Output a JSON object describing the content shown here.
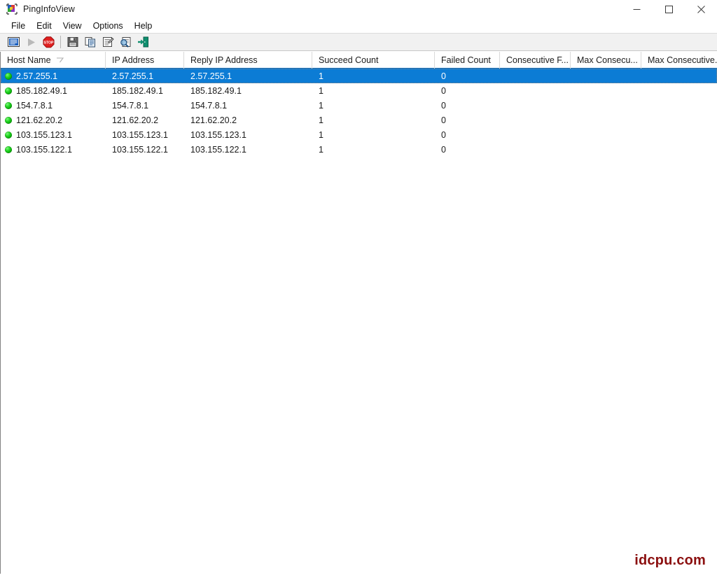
{
  "window": {
    "title": "PingInfoView",
    "app_icon": "app-icon",
    "controls": {
      "minimize": "minimize-button",
      "maximize": "maximize-button",
      "close": "close-button"
    }
  },
  "menubar": {
    "items": [
      {
        "label": "File"
      },
      {
        "label": "Edit"
      },
      {
        "label": "View"
      },
      {
        "label": "Options"
      },
      {
        "label": "Help"
      }
    ]
  },
  "toolbar": {
    "buttons": [
      {
        "name": "list-view-icon",
        "title": "Show Ping Window"
      },
      {
        "name": "play-icon",
        "title": "Resume"
      },
      {
        "name": "stop-icon",
        "title": "Stop"
      },
      {
        "name": "save-icon",
        "title": "Save"
      },
      {
        "name": "copy-icon",
        "title": "Copy"
      },
      {
        "name": "properties-icon",
        "title": "Properties"
      },
      {
        "name": "find-icon",
        "title": "Find"
      },
      {
        "name": "exit-icon",
        "title": "Exit"
      }
    ]
  },
  "listview": {
    "sort_column": "Host Name",
    "sort_direction": "descending",
    "selected_row_index": 0,
    "columns": [
      {
        "label": "Host Name",
        "width": 150
      },
      {
        "label": "IP Address",
        "width": 112
      },
      {
        "label": "Reply IP Address",
        "width": 183
      },
      {
        "label": "Succeed Count",
        "width": 175
      },
      {
        "label": "Failed Count",
        "width": 93
      },
      {
        "label": "Consecutive F...",
        "width": 101
      },
      {
        "label": "Max Consecu...",
        "width": 101
      },
      {
        "label": "Max Consecutive...",
        "width": 109
      }
    ],
    "rows": [
      {
        "status": "ok",
        "host_name": "2.57.255.1",
        "ip_address": "2.57.255.1",
        "reply_ip_address": "2.57.255.1",
        "succeed_count": "1",
        "failed_count": "0",
        "consecutive_failed": "",
        "max_consecutive_succeeded": "",
        "max_consecutive_failed": ""
      },
      {
        "status": "ok",
        "host_name": "185.182.49.1",
        "ip_address": "185.182.49.1",
        "reply_ip_address": "185.182.49.1",
        "succeed_count": "1",
        "failed_count": "0",
        "consecutive_failed": "",
        "max_consecutive_succeeded": "",
        "max_consecutive_failed": ""
      },
      {
        "status": "ok",
        "host_name": "154.7.8.1",
        "ip_address": "154.7.8.1",
        "reply_ip_address": "154.7.8.1",
        "succeed_count": "1",
        "failed_count": "0",
        "consecutive_failed": "",
        "max_consecutive_succeeded": "",
        "max_consecutive_failed": ""
      },
      {
        "status": "ok",
        "host_name": "121.62.20.2",
        "ip_address": "121.62.20.2",
        "reply_ip_address": "121.62.20.2",
        "succeed_count": "1",
        "failed_count": "0",
        "consecutive_failed": "",
        "max_consecutive_succeeded": "",
        "max_consecutive_failed": ""
      },
      {
        "status": "ok",
        "host_name": "103.155.123.1",
        "ip_address": "103.155.123.1",
        "reply_ip_address": "103.155.123.1",
        "succeed_count": "1",
        "failed_count": "0",
        "consecutive_failed": "",
        "max_consecutive_succeeded": "",
        "max_consecutive_failed": ""
      },
      {
        "status": "ok",
        "host_name": "103.155.122.1",
        "ip_address": "103.155.122.1",
        "reply_ip_address": "103.155.122.1",
        "succeed_count": "1",
        "failed_count": "0",
        "consecutive_failed": "",
        "max_consecutive_succeeded": "",
        "max_consecutive_failed": ""
      }
    ]
  },
  "watermark": {
    "text": "idcpu.com"
  },
  "colors": {
    "selection": "#0c7cd5",
    "header_underline": "#0d6cbd",
    "toolbar_bg": "#f1f1f1",
    "status_ok": "#06a806",
    "watermark": "#8b0f0f"
  }
}
